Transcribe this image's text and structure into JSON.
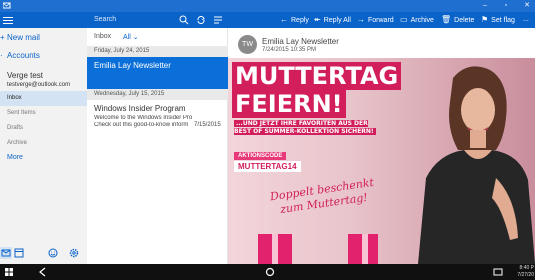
{
  "colors": {
    "accent": "#0a63c9",
    "selected": "#0a6fd8",
    "promo_pink": "#d21f5b"
  },
  "nav": {
    "new_mail": "New mail",
    "accounts": "Accounts",
    "account_name": "Verge test",
    "account_email": "testverge@outlook.com",
    "folders": [
      {
        "label": "Inbox",
        "active": true
      },
      {
        "label": "Sent Items",
        "active": false
      },
      {
        "label": "Drafts",
        "active": false
      },
      {
        "label": "Archive",
        "active": false
      }
    ],
    "more": "More",
    "bottom_icons": [
      "mail-icon",
      "calendar-icon",
      "smiley-icon",
      "settings-icon"
    ]
  },
  "search": {
    "placeholder": "Search"
  },
  "toolbar": {
    "reply": "Reply",
    "reply_all": "Reply All",
    "forward": "Forward",
    "archive": "Archive",
    "delete": "Delete",
    "set_flag": "Set flag",
    "more": "..."
  },
  "list": {
    "folder_title": "Inbox",
    "filter": "All",
    "groups": [
      {
        "date": "Friday, July 24, 2015",
        "messages": [
          {
            "from": "Emilia Lay Newsletter",
            "subject": "",
            "preview": "",
            "date": "",
            "selected": true
          }
        ]
      },
      {
        "date": "Wednesday, July 15, 2015",
        "messages": [
          {
            "from": "Windows Insider Program",
            "subject": "Welcome to the Windows Insider Pro",
            "preview": "Check out this good-to-know inform",
            "date": "7/15/2015",
            "selected": false
          }
        ]
      }
    ]
  },
  "reading": {
    "avatar_initials": "TW",
    "sender": "Emilia Lay Newsletter",
    "date": "7/24/2015 10:35 PM",
    "promo": {
      "headline1": "MUTTERTAG",
      "headline2": "FEIERN!",
      "subline": "...UND JETZT IHRE FAVORITEN AUS DER BEST OF SUMMER-KOLLEKTION SICHERN!",
      "code_label": "AKTIONSCODE",
      "code": "MUTTERTAG14",
      "script_line1": "Doppelt beschenkt",
      "script_line2": "zum Muttertag!"
    }
  },
  "taskbar": {
    "time": "8:40 P",
    "date": "7/27/20"
  }
}
